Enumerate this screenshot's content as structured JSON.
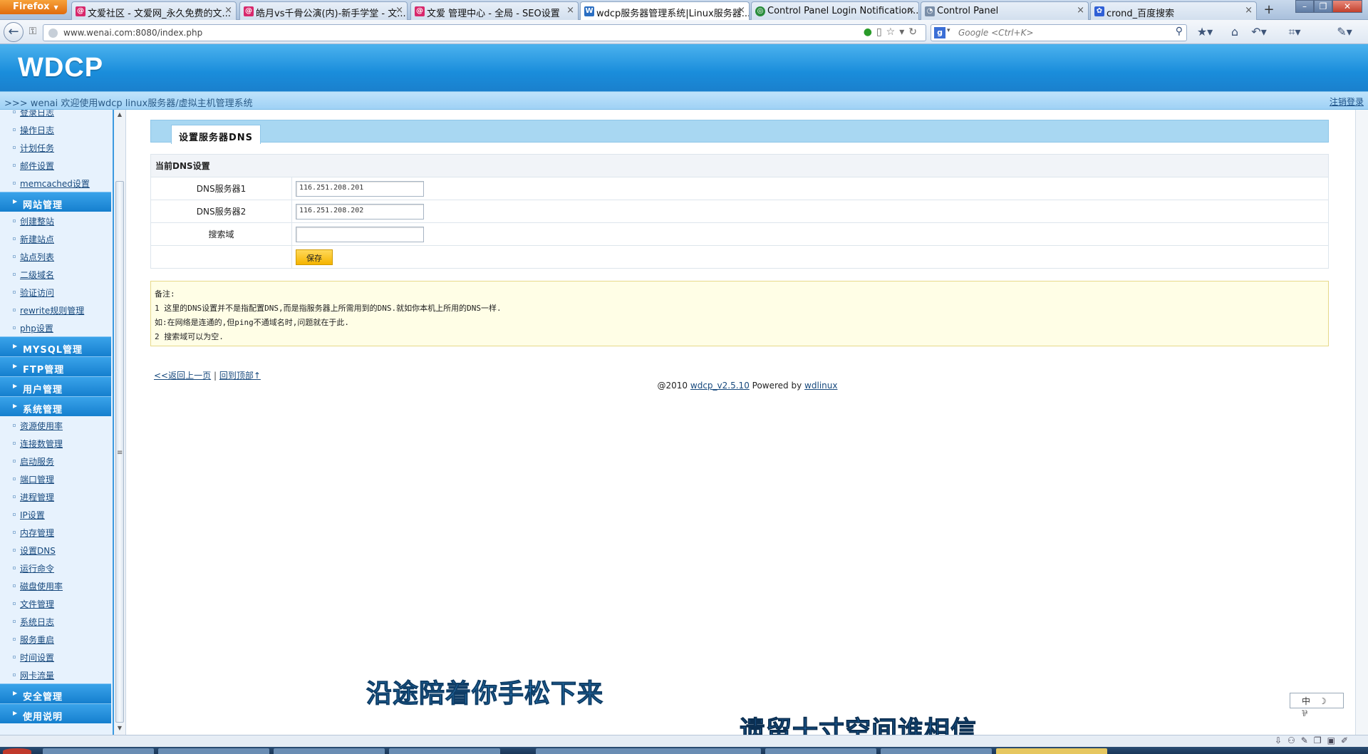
{
  "browser": {
    "firefox_label": "Firefox",
    "tabs": [
      {
        "title": "文爱社区 - 文爱网_永久免费的文...",
        "favicon": "wenai-icon",
        "color": "#d8286c"
      },
      {
        "title": "皓月vs千骨公演(内)-新手学堂 - 文...",
        "favicon": "wenai-icon",
        "color": "#d8286c"
      },
      {
        "title": "文爱 管理中心 - 全局 - SEO设置",
        "favicon": "wenai-icon",
        "color": "#d8286c"
      },
      {
        "title": "wdcp服务器管理系统|Linux服务器...",
        "favicon": "wdcp-icon",
        "color": "#2c6fc2",
        "active": true
      },
      {
        "title": "Control Panel Login Notification...",
        "favicon": "chrome-icon",
        "color": "#2a8d3c"
      },
      {
        "title": "Control Panel",
        "favicon": "page-icon",
        "color": "#7a8ea8"
      },
      {
        "title": "crond_百度搜索",
        "favicon": "baidu-icon",
        "color": "#2f5fd6"
      }
    ],
    "new_tab_label": "+",
    "url": "www.wenai.com:8080/index.php",
    "search_placeholder": "Google <Ctrl+K>",
    "search_engine_letter": "g"
  },
  "page": {
    "logo": "WDCP",
    "welcome": ">>> wenai 欢迎使用wdcp linux服务器/虚拟主机管理系统",
    "logout": "注销登录",
    "sidebar": {
      "top_links": [
        "登录日志",
        "操作日志",
        "计划任务",
        "邮件设置",
        "memcached设置"
      ],
      "site_head": "网站管理",
      "site_links": [
        "创建整站",
        "新建站点",
        "站点列表",
        "二级域名",
        "验证访问",
        "rewrite规则管理",
        "php设置"
      ],
      "mysql_head": "MYSQL管理",
      "ftp_head": "FTP管理",
      "user_head": "用户管理",
      "system_head": "系统管理",
      "system_links": [
        "资源使用率",
        "连接数管理",
        "启动服务",
        "端口管理",
        "进程管理",
        "IP设置",
        "内存管理",
        "设置DNS",
        "运行命令",
        "磁盘使用率",
        "文件管理",
        "系统日志",
        "服务重启",
        "时间设置",
        "网卡流量"
      ],
      "security_head": "安全管理",
      "manual_head": "使用说明"
    },
    "title": "设置服务器DNS",
    "section_title": "当前DNS设置",
    "dns1_label": "DNS服务器1",
    "dns1_value": "116.251.208.201",
    "dns2_label": "DNS服务器2",
    "dns2_value": "116.251.208.202",
    "search_domain_label": "搜索域",
    "search_domain_value": "",
    "save_label": "保存",
    "notes": [
      "备注:",
      "1 这里的DNS设置并不是指配置DNS,而是指服务器上所需用到的DNS.就如你本机上所用的DNS一样.",
      "如:在网络是连通的,但ping不通域名时,问题就在于此.",
      "2 搜索域可以为空."
    ],
    "back_link": "<<返回上一页",
    "separator": "|",
    "top_link": "回到顶部↑",
    "copyright_prefix": "@2010",
    "version_link": "wdcp_v2.5.10",
    "powered_by": "Powered by",
    "author_link": "wdlinux"
  },
  "overlay": {
    "lyric_line_1": "沿途陪着你手松下来",
    "lyric_line_2": "遗留十寸空间谁相信",
    "ime_text": "中 ☽ ⅌"
  }
}
